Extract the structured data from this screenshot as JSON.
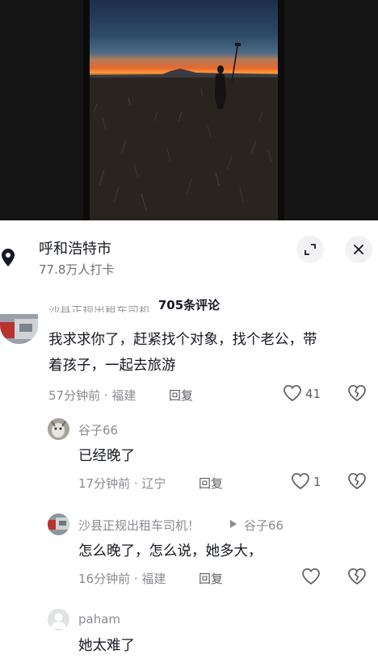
{
  "location": {
    "title": "呼和浩特市",
    "checkins": "77.8万人打卡"
  },
  "comments_header": "705条评论",
  "comments": [
    {
      "name_clipped": "沙县正规出租车司机",
      "text_line1": "我求求你了，赶紧找个对象，找个老公，带",
      "text_line2": "着孩子，一起去旅游",
      "meta": "57分钟前 · 福建",
      "reply": "回复",
      "likes": "41"
    },
    {
      "name": "谷子66",
      "text": "已经晚了",
      "meta": "17分钟前 · 辽宁",
      "reply": "回复",
      "likes": "1"
    },
    {
      "name": "沙县正规出租车司机！",
      "reply_to": "谷子66",
      "text": "怎么晚了，怎么说，她多大，",
      "meta": "16分钟前 · 福建",
      "reply": "回复",
      "likes": ""
    },
    {
      "name": "paham",
      "text": "她太难了"
    }
  ],
  "colors": {
    "meta_gray": "#8a8b91",
    "text_dark": "#161823",
    "button_bg": "#f2f2f4"
  },
  "icons": [
    "location-pin-icon",
    "expand-icon",
    "close-icon",
    "heart-icon",
    "broken-heart-icon",
    "play-triangle-icon"
  ]
}
